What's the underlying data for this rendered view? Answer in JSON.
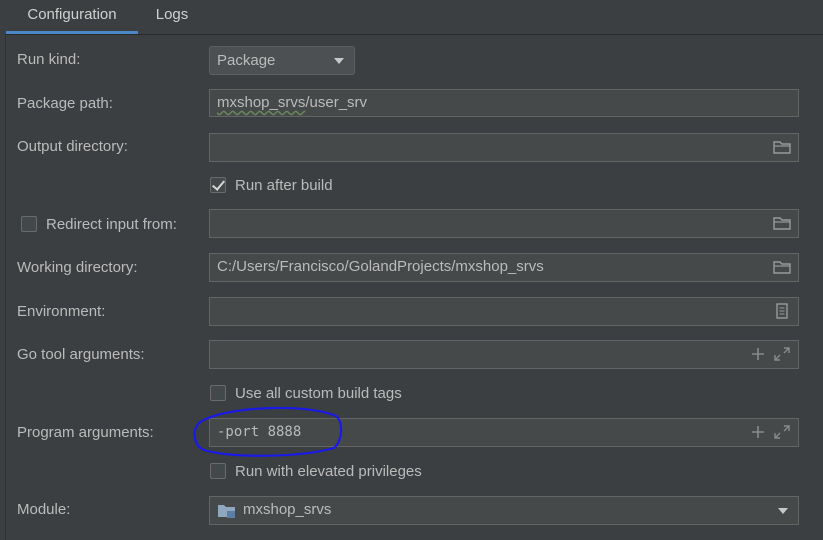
{
  "tabs": [
    {
      "label": "Configuration",
      "active": true
    },
    {
      "label": "Logs",
      "active": false
    }
  ],
  "form": {
    "run_kind": {
      "label": "Run kind:",
      "value": "Package"
    },
    "package_path": {
      "label": "Package path:",
      "value_underlined": "mxshop_srvs",
      "value_rest": "/user_srv"
    },
    "output_directory": {
      "label": "Output directory:",
      "value": "",
      "icon": "folder-icon"
    },
    "run_after_build": {
      "label": "Run after build",
      "checked": true
    },
    "redirect_input": {
      "label": "Redirect input from:",
      "checked": false,
      "value": "",
      "icon": "folder-icon"
    },
    "working_directory": {
      "label": "Working directory:",
      "value": "C:/Users/Francisco/GolandProjects/mxshop_srvs",
      "icon": "folder-icon"
    },
    "environment": {
      "label": "Environment:",
      "value": "",
      "icon": "document-icon"
    },
    "go_tool_arguments": {
      "label": "Go tool arguments:",
      "value": "",
      "icons": [
        "plus-icon",
        "expand-icon"
      ]
    },
    "use_all_custom_build_tags": {
      "label": "Use all custom build tags",
      "checked": false
    },
    "program_arguments": {
      "label": "Program arguments:",
      "value": "-port 8888",
      "icons": [
        "plus-icon",
        "expand-icon"
      ]
    },
    "run_with_elevated_privileges": {
      "label": "Run with elevated privileges",
      "checked": false
    },
    "module": {
      "label": "Module:",
      "value": "mxshop_srvs",
      "icon": "module-folder-icon"
    }
  },
  "colors": {
    "background": "#3c3f41",
    "field_bg": "#45494a",
    "tab_underline": "#4a88c7",
    "annotation": "#1010e0"
  }
}
